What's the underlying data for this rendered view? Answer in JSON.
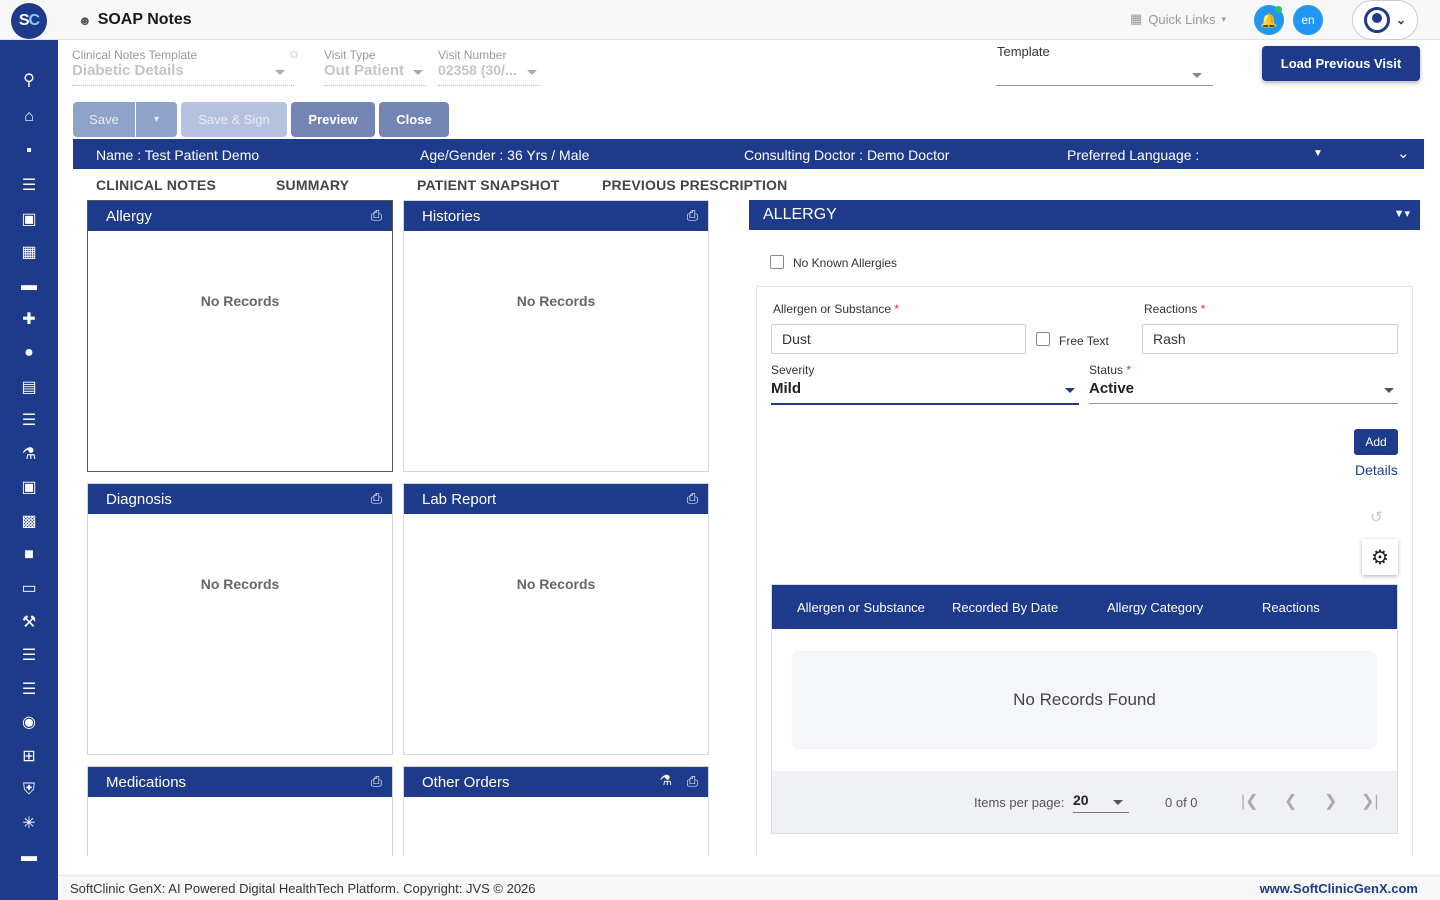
{
  "header": {
    "logo_text_s": "S",
    "logo_text_c": "C",
    "app_title": "SOAP Notes",
    "quick_links": "Quick Links",
    "lang": "en"
  },
  "form": {
    "template_label": "Clinical Notes Template",
    "template_value": "Diabetic Details",
    "visit_type_label": "Visit Type",
    "visit_type_value": "Out Patient",
    "visit_number_label": "Visit Number",
    "visit_number_value": "02358 (30/...",
    "template2_label": "Template",
    "template2_value": "",
    "load_previous": "Load Previous Visit"
  },
  "actions": {
    "save": "Save",
    "save_sign": "Save & Sign",
    "preview": "Preview",
    "close": "Close"
  },
  "patient": {
    "name": "Name :  Test Patient Demo",
    "age_gender": "Age/Gender :  36 Yrs / Male",
    "doctor": "Consulting Doctor :  Demo Doctor",
    "language": "Preferred Language :"
  },
  "tabs": [
    "CLINICAL NOTES",
    "SUMMARY",
    "PATIENT SNAPSHOT",
    "PREVIOUS PRESCRIPTION"
  ],
  "cards": {
    "allergy": "Allergy",
    "histories": "Histories",
    "diagnosis": "Diagnosis",
    "lab_report": "Lab Report",
    "medications": "Medications",
    "other_orders": "Other Orders",
    "no_records": "No Records"
  },
  "allergy_panel": {
    "title": "ALLERGY",
    "no_known": "No Known Allergies",
    "allergen_label": "Allergen or Substance",
    "allergen_value": "Dust",
    "free_text": "Free Text",
    "reactions_label": "Reactions",
    "reactions_value": "Rash",
    "severity_label": "Severity",
    "severity_value": "Mild",
    "status_label": "Status",
    "status_value": "Active",
    "required_mark": "*",
    "add": "Add",
    "details": "Details",
    "columns": [
      "Allergen or Substance",
      "Recorded By Date",
      "Allergy Category",
      "Reactions"
    ],
    "empty": "No Records Found",
    "items_per_page_label": "Items per page:",
    "items_per_page": "20",
    "range": "0 of 0"
  },
  "footer": {
    "copyright": "SoftClinic GenX: AI Powered Digital HealthTech Platform. Copyright: JVS © 2026",
    "site": "www.SoftClinicGenX.com"
  },
  "colors": {
    "brand": "#1e3a8a",
    "accent": "#2196f3"
  }
}
